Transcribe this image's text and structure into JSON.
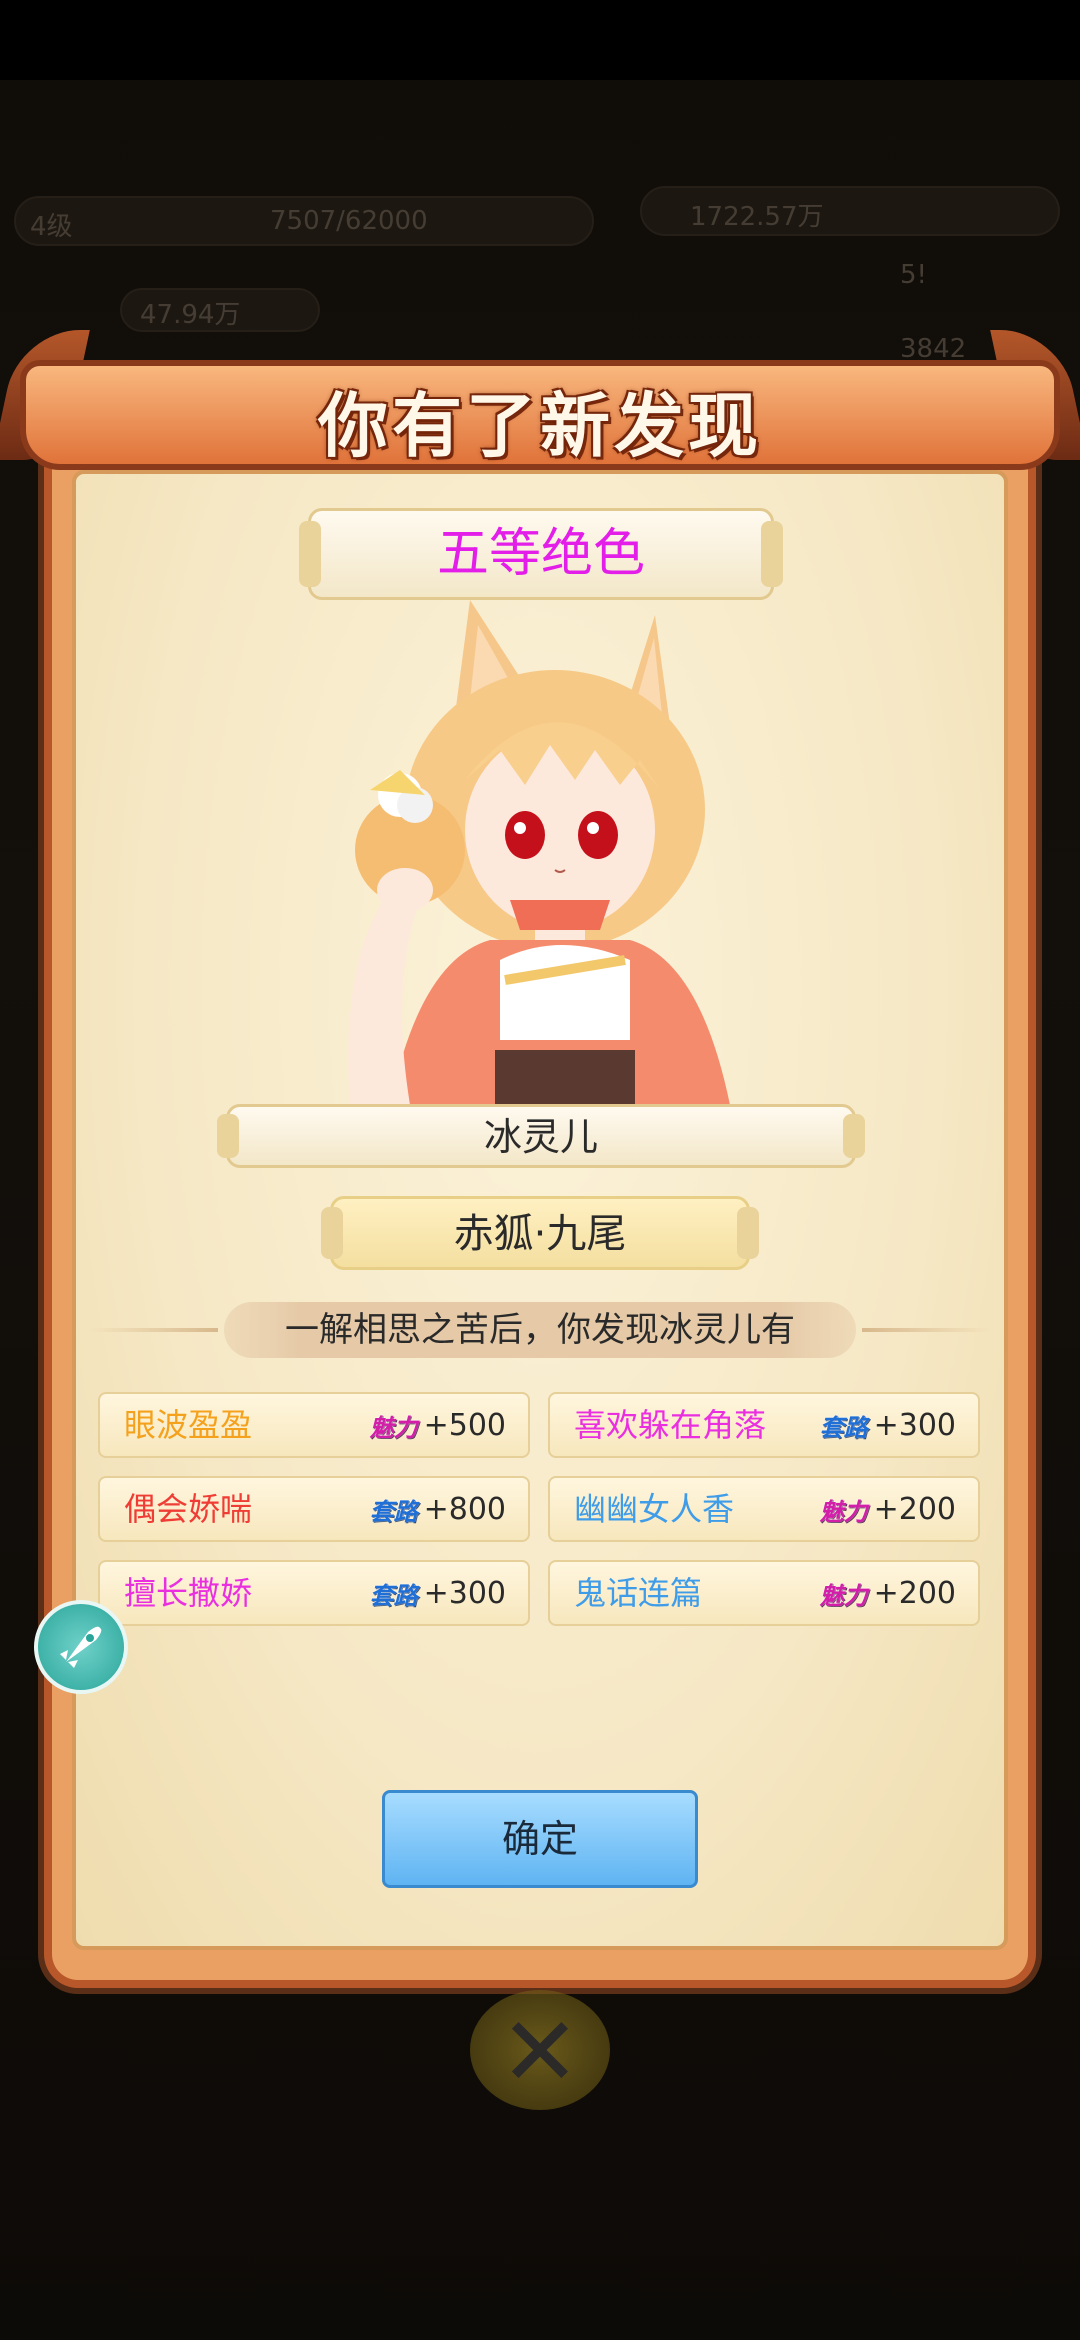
{
  "hud": {
    "level_badge": "4级",
    "exp": "7507/62000",
    "silver": "1722.57万",
    "power": "47.94万",
    "stat_a": "5!",
    "stat_b": "3842"
  },
  "dialog": {
    "title": "你有了新发现",
    "rank": "五等绝色",
    "character_name": "冰灵儿",
    "character_subtitle": "赤狐·九尾",
    "description": "一解相思之苦后，你发现冰灵儿有",
    "confirm_label": "确定"
  },
  "stat_labels": {
    "charm": "魅力",
    "skill": "套路"
  },
  "traits": [
    {
      "name": "眼波盈盈",
      "stat": "魅力",
      "value": "+500",
      "color": "#f4a21e"
    },
    {
      "name": "喜欢躲在角落",
      "stat": "套路",
      "value": "+300",
      "color": "#ea2fe1"
    },
    {
      "name": "偶会娇喘",
      "stat": "套路",
      "value": "+800",
      "color": "#ef3d35"
    },
    {
      "name": "幽幽女人香",
      "stat": "魅力",
      "value": "+200",
      "color": "#3f9ce8"
    },
    {
      "name": "擅长撒娇",
      "stat": "套路",
      "value": "+300",
      "color": "#ea2fe1"
    },
    {
      "name": "鬼话连篇",
      "stat": "魅力",
      "value": "+200",
      "color": "#3f9ce8"
    }
  ],
  "icons": {
    "rocket": "rocket-icon",
    "close": "close-icon"
  }
}
